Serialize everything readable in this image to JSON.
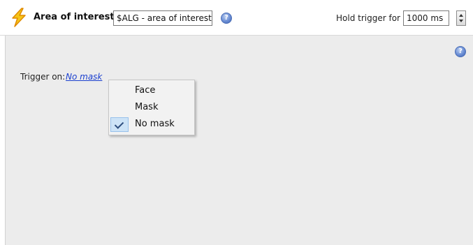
{
  "header": {
    "title": "Area of interest",
    "name_value": "$ALG - area of interest",
    "help_glyph": "?",
    "hold_label": "Hold trigger for",
    "hold_value": "1000 ms",
    "icon": "lightning-bolt-icon"
  },
  "panel": {
    "help_glyph": "?",
    "trigger_label": "Trigger on:",
    "trigger_value": "No mask"
  },
  "menu": {
    "items": [
      {
        "label": "Face",
        "checked": false
      },
      {
        "label": "Mask",
        "checked": false
      },
      {
        "label": "No mask",
        "checked": true
      }
    ]
  },
  "colors": {
    "link": "#1a3fcf",
    "panel_bg": "#ececec",
    "bolt_fill": "#f5c518",
    "bolt_outline": "#e08a00",
    "menu_selected": "#cde3f7"
  }
}
